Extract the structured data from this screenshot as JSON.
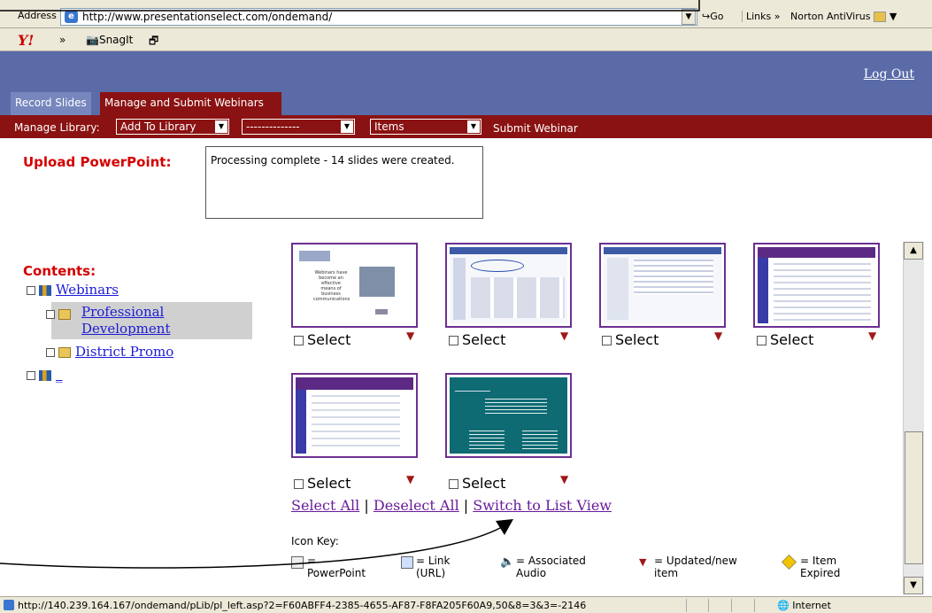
{
  "browser": {
    "address_label": "Address",
    "url": "http://www.presentationselect.com/ondemand/",
    "go_label": "Go",
    "links_label": "Links",
    "norton_label": "Norton AntiVirus",
    "snagit_label": "SnagIt",
    "status_url": "http://140.239.164.167/ondemand/pLib/pl_left.asp?2=F60ABFF4-2385-4655-AF87-F8FA205F60A9,50&8=3&3=-2146",
    "status_zone": "Internet"
  },
  "header": {
    "logout": "Log Out",
    "tabs": [
      {
        "label": "Record Slides"
      },
      {
        "label": "Manage and Submit Webinars"
      }
    ]
  },
  "menu": {
    "manage_label": "Manage Library:",
    "select1": "Add To Library",
    "select2": "--------------",
    "select3": "Items",
    "submit": "Submit Webinar"
  },
  "upload": {
    "label": "Upload PowerPoint:",
    "status": "Processing complete - 14 slides were created."
  },
  "contents": {
    "label": "Contents:",
    "items": [
      {
        "label": "Webinars"
      },
      {
        "label": "Professional"
      },
      {
        "label": "Development"
      },
      {
        "label": "District Promo"
      },
      {
        "label": "_"
      }
    ]
  },
  "slides": {
    "select_label": "Select",
    "slide1_caption": "Webinars have become an effective means of business communications"
  },
  "actions": {
    "select_all": "Select All",
    "sep": "|",
    "deselect_all": "Deselect All",
    "switch_view": "Switch to List View"
  },
  "icon_key": {
    "label": "Icon Key:",
    "items": [
      {
        "icon": "powerpoint-icon",
        "label": "= PowerPoint"
      },
      {
        "icon": "link-icon",
        "label": "= Link (URL)"
      },
      {
        "icon": "audio-icon",
        "label": "= Associated Audio"
      },
      {
        "icon": "flag-icon",
        "label": "= Updated/new item"
      },
      {
        "icon": "expired-icon",
        "label": "= Item Expired"
      }
    ]
  }
}
